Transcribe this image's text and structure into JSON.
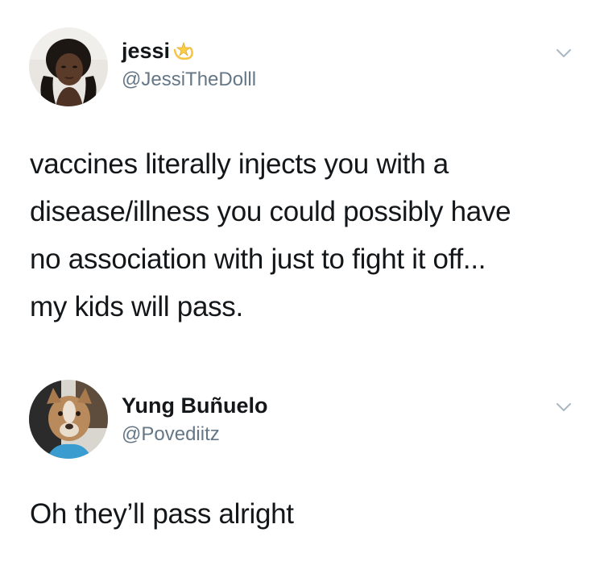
{
  "tweets": [
    {
      "display_name": "jessi",
      "name_emoji": "dizzy-star-emoji",
      "handle": "@JessiTheDolll",
      "text_lines": [
        "vaccines literally injects you with a",
        "disease/illness you could possibly have",
        "no association with just to fight it off...",
        "my kids will pass."
      ]
    },
    {
      "display_name": "Yung Buñuelo",
      "handle": "@Povediitz",
      "text_lines": [
        "Oh they’ll pass alright"
      ]
    }
  ],
  "icons": {
    "menu": "chevron-down-icon"
  },
  "colors": {
    "text": "#14171a",
    "handle": "#657786",
    "chevron": "#aab8c2"
  }
}
